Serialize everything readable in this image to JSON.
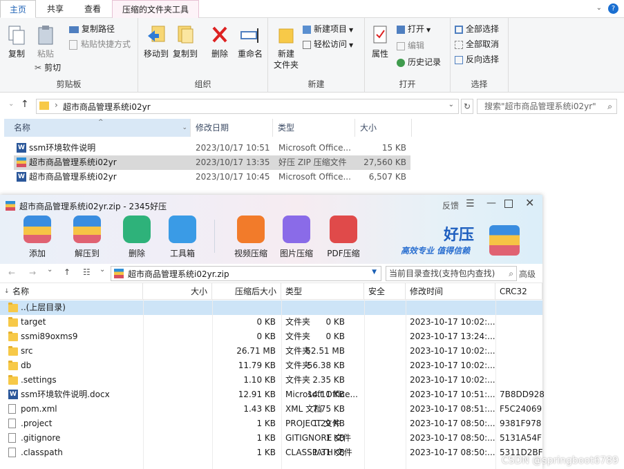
{
  "explorer": {
    "tabs": [
      "主页",
      "共享",
      "查看"
    ],
    "tool_tab": "压缩的文件夹工具",
    "groups": {
      "clipboard": {
        "label": "剪贴板",
        "copy": "复制",
        "paste": "粘贴",
        "copy_path": "复制路径",
        "paste_shortcut": "粘贴快捷方式",
        "cut": "剪切"
      },
      "organize": {
        "label": "组织",
        "move_to": "移动到",
        "copy_to": "复制到",
        "delete": "删除",
        "rename": "重命名"
      },
      "new": {
        "label": "新建",
        "new_folder_1": "新建",
        "new_folder_2": "文件夹",
        "new_item": "新建项目",
        "easy_access": "轻松访问"
      },
      "open": {
        "label": "打开",
        "properties": "属性",
        "open": "打开",
        "edit": "编辑",
        "history": "历史记录"
      },
      "select": {
        "label": "选择",
        "select_all": "全部选择",
        "select_none": "全部取消",
        "invert": "反向选择"
      }
    },
    "address": "超市商品管理系统i02yr",
    "search_placeholder": "搜索\"超市商品管理系统i02yr\"",
    "columns": [
      "名称",
      "修改日期",
      "类型",
      "大小"
    ],
    "files": [
      {
        "name": "ssm环境软件说明",
        "date": "2023/10/17 10:51",
        "type": "Microsoft Office...",
        "size": "15 KB",
        "icon": "word"
      },
      {
        "name": "超市商品管理系统i02yr",
        "date": "2023/10/17 13:35",
        "type": "好压 ZIP 压缩文件",
        "size": "27,560 KB",
        "icon": "zip"
      },
      {
        "name": "超市商品管理系统i02yr",
        "date": "2023/10/17 10:45",
        "type": "Microsoft Office...",
        "size": "6,507 KB",
        "icon": "word"
      }
    ]
  },
  "zip": {
    "title": "超市商品管理系统i02yr.zip - 2345好压",
    "feedback": "反馈",
    "toolbar": [
      "添加",
      "解压到",
      "删除",
      "工具箱",
      "视频压缩",
      "图片压缩",
      "PDF压缩"
    ],
    "brand": "好压",
    "slogan": "高效专业  值得信赖",
    "path": "超市商品管理系统i02yr.zip",
    "search_placeholder": "当前目录查找(支持包内查找)",
    "advanced": "高级",
    "columns": [
      "名称",
      "大小",
      "压缩后大小",
      "类型",
      "安全",
      "修改时间",
      "CRC32"
    ],
    "rows": [
      {
        "name": "..(上层目录)",
        "size": "",
        "packed": "",
        "type": "",
        "time": "",
        "crc": "",
        "icon": "folder"
      },
      {
        "name": "target",
        "size": "0 KB",
        "packed": "0 KB",
        "type": "文件夹",
        "time": "2023-10-17 10:02:...",
        "crc": "",
        "icon": "folder"
      },
      {
        "name": "ssmi89oxms9",
        "size": "0 KB",
        "packed": "0 KB",
        "type": "文件夹",
        "time": "2023-10-17 13:24:...",
        "crc": "",
        "icon": "folder"
      },
      {
        "name": "src",
        "size": "52.51 MB",
        "packed": "26.71 MB",
        "type": "文件夹",
        "time": "2023-10-17 10:02:...",
        "crc": "",
        "icon": "folder"
      },
      {
        "name": "db",
        "size": "56.38 KB",
        "packed": "11.79 KB",
        "type": "文件夹",
        "time": "2023-10-17 10:02:...",
        "crc": "",
        "icon": "folder"
      },
      {
        "name": ".settings",
        "size": "2.35 KB",
        "packed": "1.10 KB",
        "type": "文件夹",
        "time": "2023-10-17 10:02:...",
        "crc": "",
        "icon": "folder"
      },
      {
        "name": "ssm环境软件说明.docx",
        "size": "14.11 KB",
        "packed": "12.91 KB",
        "type": "Microsoft Office...",
        "time": "2023-10-17 10:51:...",
        "crc": "7B8DD928",
        "icon": "word"
      },
      {
        "name": "pom.xml",
        "size": "7.75 KB",
        "packed": "1.43 KB",
        "type": "XML 文档",
        "time": "2023-10-17 08:51:...",
        "crc": "F5C24069",
        "icon": "doc"
      },
      {
        "name": ".project",
        "size": "1.29 KB",
        "packed": "1 KB",
        "type": "PROJECT 文件",
        "time": "2023-10-17 08:50:...",
        "crc": "9381F978",
        "icon": "doc"
      },
      {
        "name": ".gitignore",
        "size": "1 KB",
        "packed": "1 KB",
        "type": "GITIGNORE 文件",
        "time": "2023-10-17 08:50:...",
        "crc": "5131A54F",
        "icon": "doc"
      },
      {
        "name": ".classpath",
        "size": "1.31 KB",
        "packed": "1 KB",
        "type": "CLASSPATH 文件",
        "time": "2023-10-17 08:50:...",
        "crc": "5311D2BF",
        "icon": "doc"
      }
    ]
  },
  "watermark": "CSDN @springboot6789"
}
